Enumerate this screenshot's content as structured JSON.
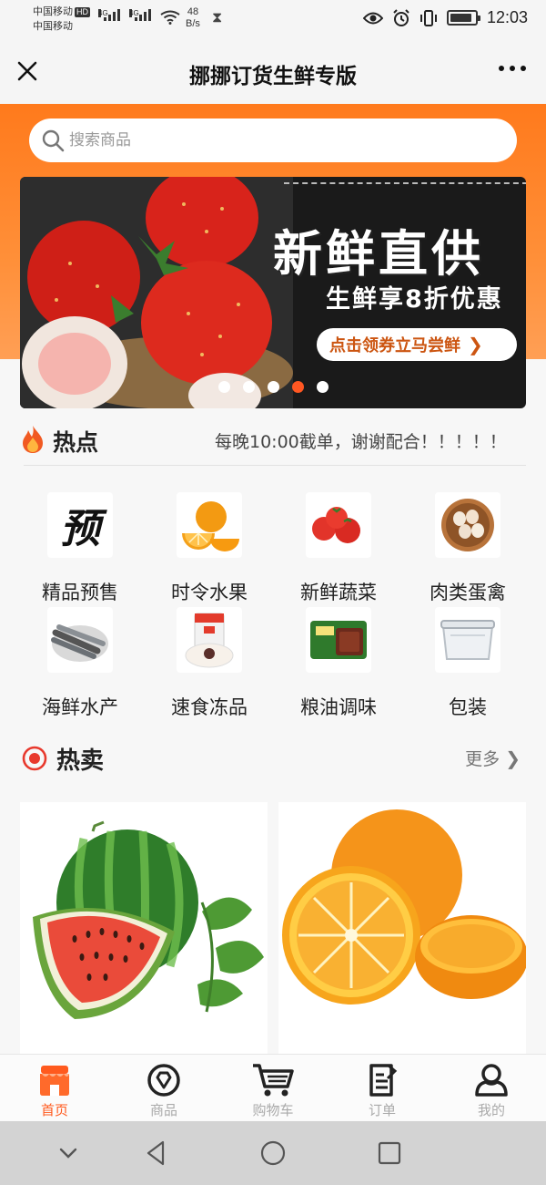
{
  "status_bar": {
    "carrier_1": "中国移动",
    "carrier_1_badge": "HD",
    "carrier_2": "中国移动",
    "net_1": "4G",
    "net_2": "4G",
    "speed_value": "48",
    "speed_unit": "B/s",
    "time": "12:03",
    "battery_level": 0.9
  },
  "title_bar": {
    "title": "挪挪订货生鲜专版",
    "close_icon": "close-icon",
    "more_icon": "more-dots-icon"
  },
  "colors": {
    "brand_orange": "#ff7a1c",
    "active_tab": "#ff5a1e",
    "hot_red": "#e8392d"
  },
  "search": {
    "placeholder": "搜索商品",
    "icon": "search-icon"
  },
  "banner": {
    "headline": "新鲜直供",
    "subtitle": "生鲜享8折优惠",
    "cta": "点击领券立马尝鲜",
    "dot_count": 5,
    "active_dot": 4
  },
  "hot_news": {
    "title": "热点",
    "icon": "fire-icon",
    "marquee": "每晚10:00截单，谢谢配合！！！！！"
  },
  "categories": [
    {
      "label": "精品预售",
      "icon": "presale-icon",
      "glyph": "预"
    },
    {
      "label": "时令水果",
      "icon": "orange-fruit-icon"
    },
    {
      "label": "新鲜蔬菜",
      "icon": "tomato-icon"
    },
    {
      "label": "肉类蛋禽",
      "icon": "eggs-icon"
    },
    {
      "label": "海鲜水产",
      "icon": "fish-icon"
    },
    {
      "label": "速食冻品",
      "icon": "dumpling-pack-icon"
    },
    {
      "label": "粮油调味",
      "icon": "sauce-box-icon"
    },
    {
      "label": "包装",
      "icon": "container-icon"
    }
  ],
  "hot_sale": {
    "title": "热卖",
    "more": "更多",
    "icon": "target-icon",
    "products": [
      {
        "name": "watermelon",
        "icon": "watermelon-image"
      },
      {
        "name": "orange",
        "icon": "orange-image"
      }
    ]
  },
  "bottom_nav": [
    {
      "label": "首页",
      "icon": "shop-icon",
      "active": true
    },
    {
      "label": "商品",
      "icon": "goods-icon",
      "active": false
    },
    {
      "label": "购物车",
      "icon": "cart-icon",
      "active": false
    },
    {
      "label": "订单",
      "icon": "order-icon",
      "active": false
    },
    {
      "label": "我的",
      "icon": "user-icon",
      "active": false
    }
  ],
  "system_nav": [
    "chevron-down-icon",
    "back-icon",
    "home-icon",
    "recents-icon"
  ]
}
